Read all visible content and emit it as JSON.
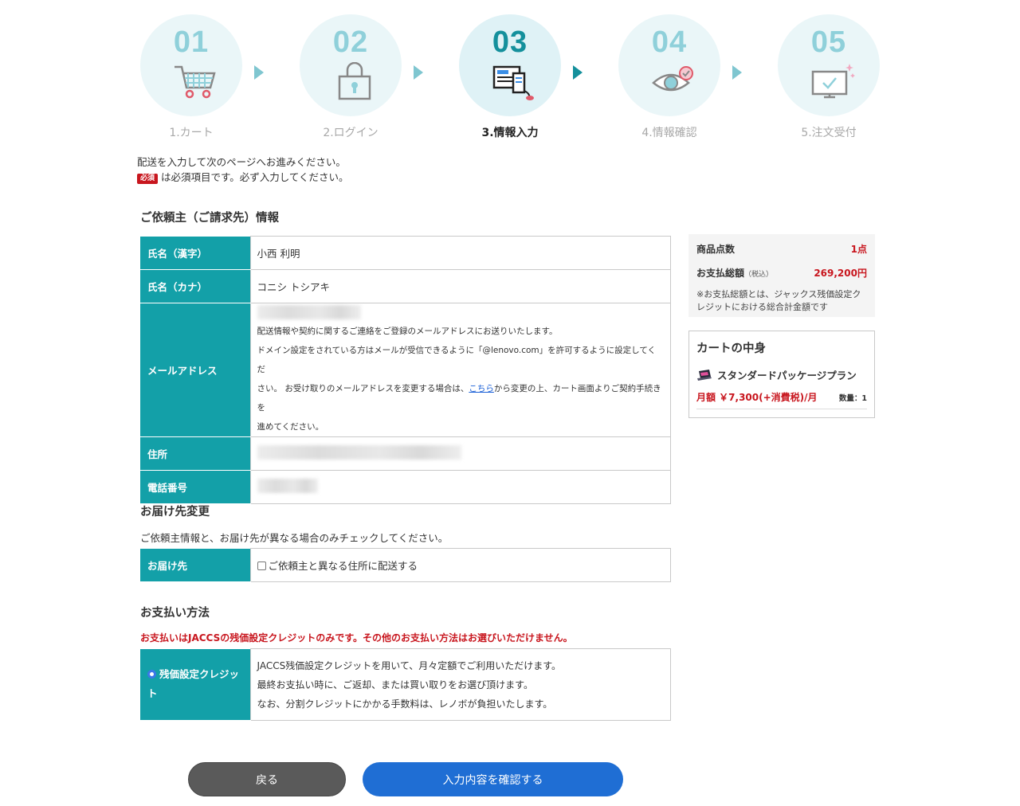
{
  "steps": [
    {
      "num": "01",
      "label": "1.カート"
    },
    {
      "num": "02",
      "label": "2.ログイン"
    },
    {
      "num": "03",
      "label": "3.情報入力"
    },
    {
      "num": "04",
      "label": "4.情報確認"
    },
    {
      "num": "05",
      "label": "5.注文受付"
    }
  ],
  "intro": {
    "line1": "配送を入力して次のページへお進みください。",
    "required_badge": "必須",
    "line2": "は必須項目です。必ず入力してください。"
  },
  "requester": {
    "title": "ご依頼主（ご請求先）情報",
    "name_kanji_label": "氏名（漢字）",
    "name_kanji_value": "小西 利明",
    "name_kana_label": "氏名（カナ）",
    "name_kana_value": "コニシ トシアキ",
    "email_label": "メールアドレス",
    "email_note1": "配送情報や契約に関するご連絡をご登録のメールアドレスにお送りいたします。",
    "email_note2": "ドメイン設定をされている方はメールが受信できるように「@lenovo.com」を許可するように設定してくだ",
    "email_note3a": "さい。 お受け取りのメールアドレスを変更する場合は、",
    "email_note3_link": "こちら",
    "email_note3b": "から変更の上、カート画面よりご契約手続きを",
    "email_note4": "進めてください。",
    "address_label": "住所",
    "phone_label": "電話番号"
  },
  "delivery": {
    "title": "お届け先変更",
    "note": "ご依頼主情報と、お届け先が異なる場合のみチェックしてください。",
    "row_label": "お届け先",
    "checkbox_label": "ご依頼主と異なる住所に配送する"
  },
  "payment": {
    "title": "お支払い方法",
    "warning": "お支払いはJACCSの残価設定クレジットのみです。その他のお支払い方法はお選びいただけません。",
    "option_label_1": "残価設定クレジッ",
    "option_label_2": "ト",
    "desc1": "JACCS残価設定クレジットを用いて、月々定額でご利用いただけます。",
    "desc2": "最終お支払い時に、ご返却、または買い取りをお選び頂けます。",
    "desc3": "なお、分割クレジットにかかる手数料は、レノボが負担いたします。"
  },
  "summary": {
    "count_label": "商品点数",
    "count_value": "1点",
    "total_label": "お支払総額",
    "total_tax": "（税込）",
    "total_value": "269,200円",
    "fine_print": "※お支払総額とは、ジャックス残価設定クレジットにおける総合計金額です"
  },
  "cart": {
    "title": "カートの中身",
    "item_name": "スタンダードパッケージプラン",
    "price": "月額 ￥7,300(+消費税)/月",
    "qty": "数量：1"
  },
  "buttons": {
    "back": "戻る",
    "confirm": "入力内容を確認する"
  },
  "colors": {
    "accent_teal": "#13a0a8",
    "required_red": "#c8161e",
    "primary_blue": "#1f6ed4",
    "back_gray": "#5a5a5a"
  }
}
